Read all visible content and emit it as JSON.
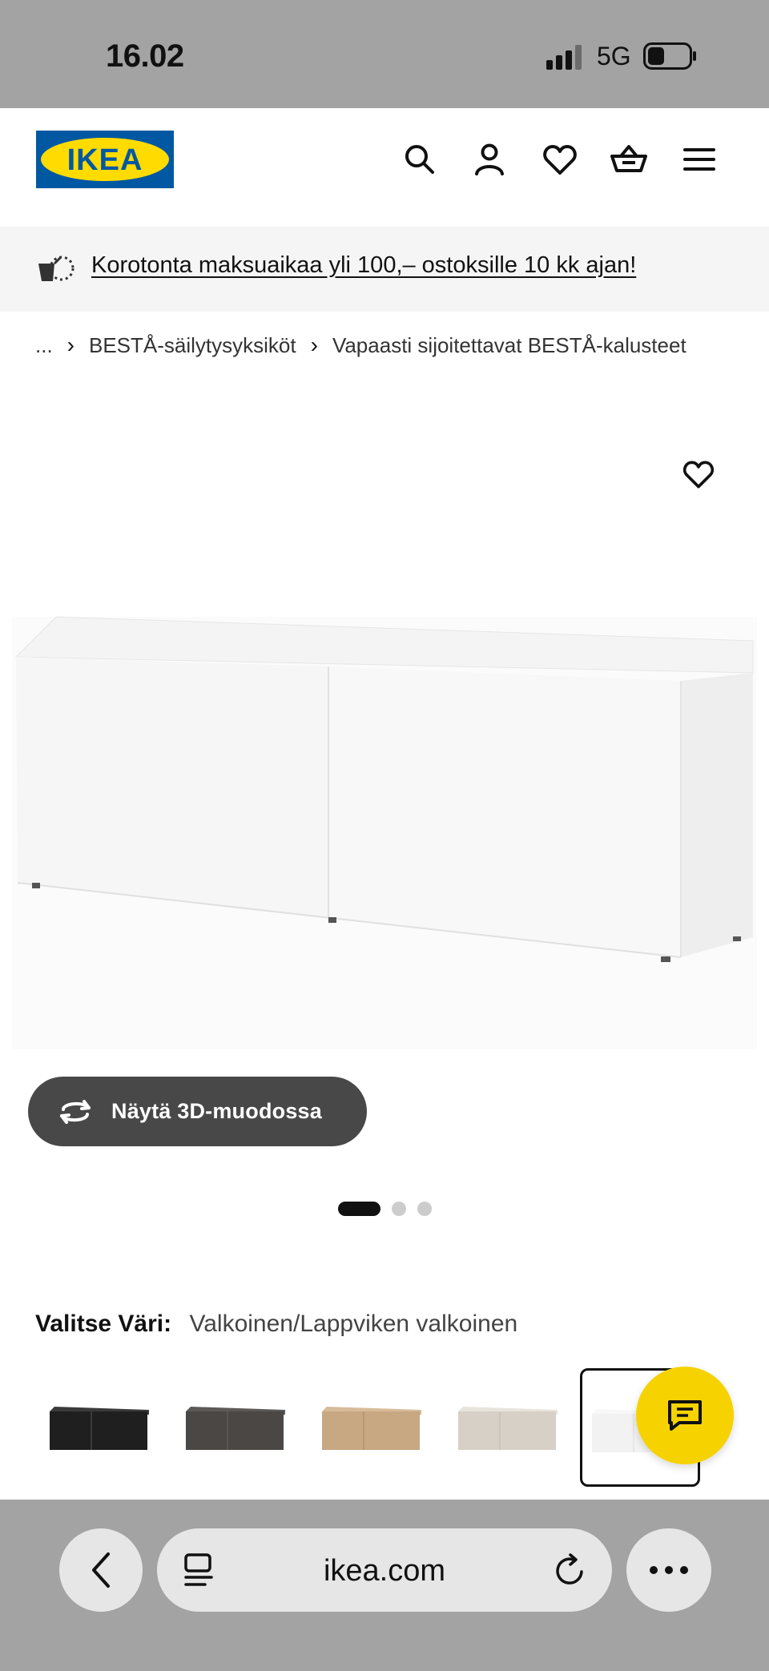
{
  "status_bar": {
    "time": "16.02",
    "network": "5G"
  },
  "header": {
    "logo_text": "IKEA",
    "brand_colors": {
      "blue": "#0058a3",
      "yellow": "#ffdb00"
    },
    "icons": [
      "search-icon",
      "account-icon",
      "wishlist-icon",
      "cart-icon",
      "menu-icon"
    ]
  },
  "promo": {
    "text": "Korotonta maksuaikaa yli 100,– ostoksille 10 kk ajan!"
  },
  "breadcrumb": {
    "ellipsis": "...",
    "items": [
      "BESTÅ-säilytysyksiköt",
      "Vapaasti sijoitettavat BESTÅ-kalusteet"
    ]
  },
  "product": {
    "view_3d_label": "Näytä 3D-muodossa",
    "image_count": 3,
    "active_image_index": 0
  },
  "color_picker": {
    "label": "Valitse Väri:",
    "selected_value": "Valkoinen/Lappviken valkoinen",
    "swatch_colors": [
      "#1f1f1f",
      "#4a4744",
      "#c8a783",
      "#d6d0c6",
      "#f2f2f2"
    ],
    "selected_index": 4
  },
  "browser": {
    "url": "ikea.com"
  }
}
